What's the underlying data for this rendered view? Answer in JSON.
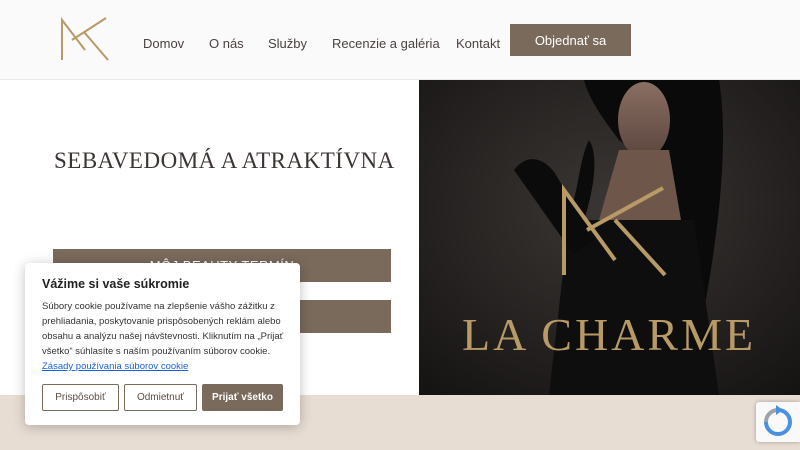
{
  "header": {
    "nav": [
      {
        "label": "Domov"
      },
      {
        "label": "O nás"
      },
      {
        "label": "Služby"
      },
      {
        "label": "Recenzie a galéria"
      },
      {
        "label": "Kontakt"
      }
    ],
    "cta_label": "Objednať sa"
  },
  "hero": {
    "title": "SEBAVEDOMÁ A ATRAKTÍVNA",
    "button1_label": "MÔJ BEAUTY TERMÍN",
    "button2_label": "",
    "brand_text": "LA CHARME"
  },
  "cookie": {
    "title": "Vážime si vaše súkromie",
    "text": "Súbory cookie používame na zlepšenie vášho zážitku z prehliadania, poskytovanie prispôsobených reklám alebo obsahu a analýzu našej návštevnosti. Kliknutím na „Prijať všetko“ súhlasíte s naším používaním súborov cookie.",
    "link": "Zásady používania súborov cookie",
    "customize_label": "Prispôsobiť",
    "reject_label": "Odmietnuť",
    "accept_label": "Prijať všetko"
  },
  "colors": {
    "accent": "#7a6a5c",
    "gold": "#b89a67",
    "band": "#e8ddd3"
  }
}
